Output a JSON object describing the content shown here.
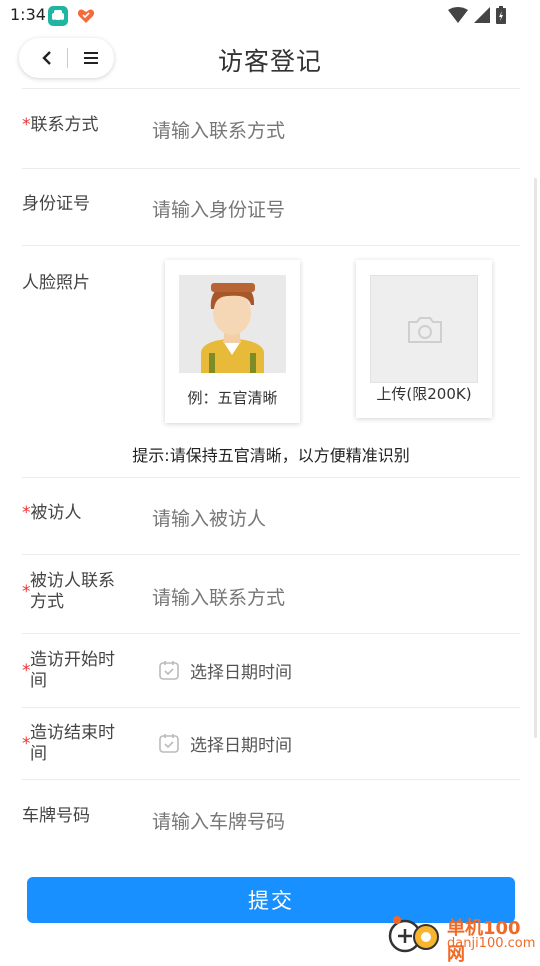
{
  "status_bar": {
    "time": "1:34"
  },
  "header": {
    "title": "访客登记"
  },
  "form": {
    "contact": {
      "required": "*",
      "label": "联系方式",
      "placeholder": "请输入联系方式"
    },
    "id_number": {
      "label": "身份证号",
      "placeholder": "请输入身份证号"
    },
    "face_photo": {
      "label": "人脸照片",
      "example_caption": "例：五官清晰",
      "upload_caption": "上传(限200K)",
      "hint": "提示:请保持五官清晰，以方便精准识别"
    },
    "visitee": {
      "required": "*",
      "label": "被访人",
      "placeholder": "请输入被访人"
    },
    "visitee_contact": {
      "required": "*",
      "label_line1": "被访人联系",
      "label_line2": "方式",
      "placeholder": "请输入联系方式"
    },
    "visit_start": {
      "required": "*",
      "label_line1": "造访开始时",
      "label_line2": "间",
      "placeholder": "选择日期时间"
    },
    "visit_end": {
      "required": "*",
      "label_line1": "造访结束时",
      "label_line2": "间",
      "placeholder": "选择日期时间"
    },
    "plate": {
      "label": "车牌号码",
      "placeholder": "请输入车牌号码"
    }
  },
  "submit_label": "提交",
  "watermark": {
    "line1": "单机100网",
    "line2": "danji100.com"
  },
  "colors": {
    "primary": "#1890ff",
    "required": "#ee3333",
    "watermark": "#f06a27"
  }
}
